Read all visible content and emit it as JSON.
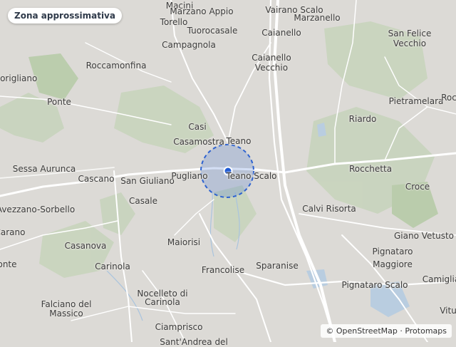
{
  "badge": {
    "label": "Zona approssimativa"
  },
  "attribution": {
    "text": "© OpenStreetMap · Protomaps"
  },
  "colors": {
    "land": "#dcdad6",
    "road": "#ffffff",
    "green": "#c8d4bd",
    "water": "#b9cde0",
    "circle_fill": "#3b6fd1",
    "marker": "#1f5bd6"
  },
  "places": [
    {
      "id": "macini",
      "label": "Macini"
    },
    {
      "id": "marzano-appio",
      "label": "Marzano Appio"
    },
    {
      "id": "vairano-scalo",
      "label": "Vairano Scalo"
    },
    {
      "id": "marzanello",
      "label": "Marzanello"
    },
    {
      "id": "torello",
      "label": "Torello"
    },
    {
      "id": "tuorocasale",
      "label": "Tuorocasale"
    },
    {
      "id": "caianello",
      "label": "Caianello"
    },
    {
      "id": "san-felice",
      "label": "San Felice"
    },
    {
      "id": "vecchio-sf",
      "label": "Vecchio"
    },
    {
      "id": "campagnola",
      "label": "Campagnola"
    },
    {
      "id": "caianello-vecchio-1",
      "label": "Caianello"
    },
    {
      "id": "caianello-vecchio-2",
      "label": "Vecchio"
    },
    {
      "id": "roccamonfina",
      "label": "Roccamonfina"
    },
    {
      "id": "corigliano",
      "label": "Corigliano"
    },
    {
      "id": "ponte",
      "label": "Ponte"
    },
    {
      "id": "pietramelara",
      "label": "Pietramelara"
    },
    {
      "id": "rocc",
      "label": "Roc"
    },
    {
      "id": "riardo",
      "label": "Riardo"
    },
    {
      "id": "casi",
      "label": "Casi"
    },
    {
      "id": "casamostra",
      "label": "Casamostra"
    },
    {
      "id": "teano",
      "label": "Teano"
    },
    {
      "id": "sessa-aurunca",
      "label": "Sessa Aurunca"
    },
    {
      "id": "cascano",
      "label": "Cascano"
    },
    {
      "id": "san-giuliano",
      "label": "San Giuliano"
    },
    {
      "id": "pugliano",
      "label": "Pugliano"
    },
    {
      "id": "teano-scalo",
      "label": "Teano Scalo"
    },
    {
      "id": "rocchetta",
      "label": "Rocchetta"
    },
    {
      "id": "croce",
      "label": "Croce"
    },
    {
      "id": "avezzano-sorbello",
      "label": "Avezzano-Sorbello"
    },
    {
      "id": "casale",
      "label": "Casale"
    },
    {
      "id": "calvi-risorta",
      "label": "Calvi Risorta"
    },
    {
      "id": "carano",
      "label": "Carano"
    },
    {
      "id": "giano-vetusto",
      "label": "Giano Vetusto"
    },
    {
      "id": "maiorisi",
      "label": "Maiorisi"
    },
    {
      "id": "casanova",
      "label": "Casanova"
    },
    {
      "id": "pignataro",
      "label": "Pignataro"
    },
    {
      "id": "maggiore",
      "label": "Maggiore"
    },
    {
      "id": "ponte-2",
      "label": "onte"
    },
    {
      "id": "carinola",
      "label": "Carinola"
    },
    {
      "id": "francolise",
      "label": "Francolise"
    },
    {
      "id": "sparanise",
      "label": "Sparanise"
    },
    {
      "id": "camiglia",
      "label": "Camiglia"
    },
    {
      "id": "pignataro-scalo",
      "label": "Pignataro Scalo"
    },
    {
      "id": "nocelleto-1",
      "label": "Nocelleto di"
    },
    {
      "id": "nocelleto-2",
      "label": "Carinola"
    },
    {
      "id": "falciano-1",
      "label": "Falciano del"
    },
    {
      "id": "falciano-2",
      "label": "Massico"
    },
    {
      "id": "vitu",
      "label": "Vitu"
    },
    {
      "id": "ciamprisco",
      "label": "Ciamprisco"
    },
    {
      "id": "sant-andrea",
      "label": "Sant'Andrea del"
    }
  ]
}
